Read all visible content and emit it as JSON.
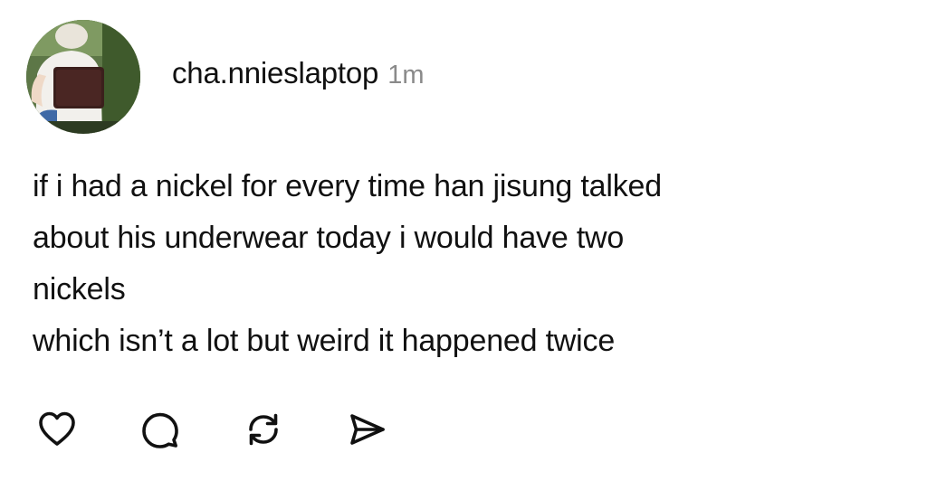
{
  "post": {
    "username": "cha.nnieslaptop",
    "timestamp": "1m",
    "avatar_icon": "profile-photo-person-with-laptop",
    "lines": [
      "if i had a nickel for every time han jisung talked",
      "about his underwear today i would have two",
      "nickels",
      "which isn’t a lot but weird it happened twice"
    ]
  },
  "actions": {
    "like_icon": "heart-icon",
    "comment_icon": "comment-bubble-icon",
    "repost_icon": "repost-icon",
    "share_icon": "send-icon"
  },
  "colors": {
    "text": "#111111",
    "timestamp": "#8a8a8a",
    "background": "#ffffff",
    "icon": "#111111"
  }
}
